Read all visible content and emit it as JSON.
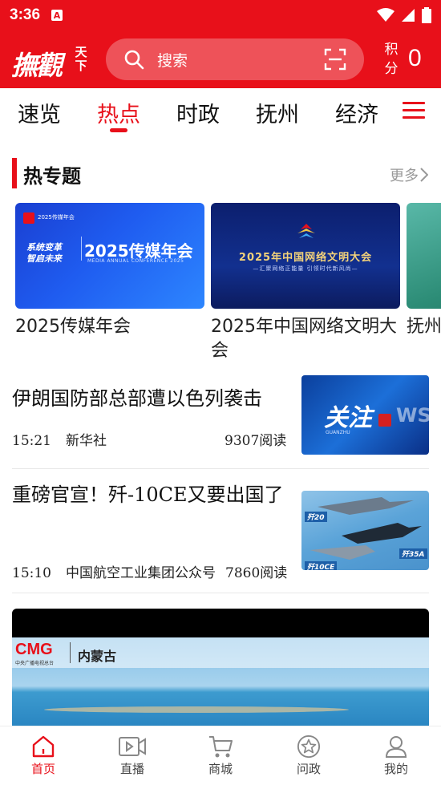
{
  "status_bar": {
    "time": "3:36",
    "app_badge": "A"
  },
  "header": {
    "logo_main": "撫觀",
    "logo_side": "天下",
    "search_placeholder": "搜索",
    "points_label": "积分",
    "points_value": "0"
  },
  "tabs": [
    {
      "label": "速览",
      "active": false
    },
    {
      "label": "热点",
      "active": true
    },
    {
      "label": "时政",
      "active": false
    },
    {
      "label": "抚州",
      "active": false
    },
    {
      "label": "经济",
      "active": false
    }
  ],
  "section": {
    "title": "热专题",
    "more": "更多"
  },
  "cards": [
    {
      "title": "2025传媒年会",
      "image": {
        "small": "2025传媒年会",
        "left_line1": "系统变革",
        "left_line2": "智启未来",
        "main": "2025传媒年会",
        "sub": "MEDIA ANNUAL CONFERENCE 2025"
      }
    },
    {
      "title": "2025年中国网络文明大会",
      "image": {
        "main": "2025年中国网络文明大会",
        "sub": "—汇聚网络正能量   引领时代新风尚—"
      }
    },
    {
      "title": "抚州"
    }
  ],
  "news": [
    {
      "title": "伊朗国防部总部遭以色列袭击",
      "time": "15:21",
      "source": "新华社",
      "reads": "9307阅读",
      "image": {
        "text": "关注",
        "sub": "GUANZHU",
        "ws": "WS"
      }
    },
    {
      "title": "重磅官宣！歼-10CE又要出国了",
      "time": "15:10",
      "source": "中国航空工业集团公众号",
      "reads": "7860阅读",
      "image": {
        "labels": [
          "歼20",
          "歼35A",
          "歼10CE"
        ]
      }
    }
  ],
  "video": {
    "brand": "CMG",
    "brand_sub": "中央广播电视总台",
    "region": "内蒙古"
  },
  "bottom_nav": [
    {
      "label": "首页",
      "icon": "home-icon",
      "active": true
    },
    {
      "label": "直播",
      "icon": "live-video-icon",
      "active": false
    },
    {
      "label": "商城",
      "icon": "cart-icon",
      "active": false
    },
    {
      "label": "问政",
      "icon": "star-badge-icon",
      "active": false
    },
    {
      "label": "我的",
      "icon": "user-icon",
      "active": false
    }
  ],
  "colors": {
    "brand_red": "#e8101a",
    "text": "#111111",
    "muted": "#999999"
  }
}
